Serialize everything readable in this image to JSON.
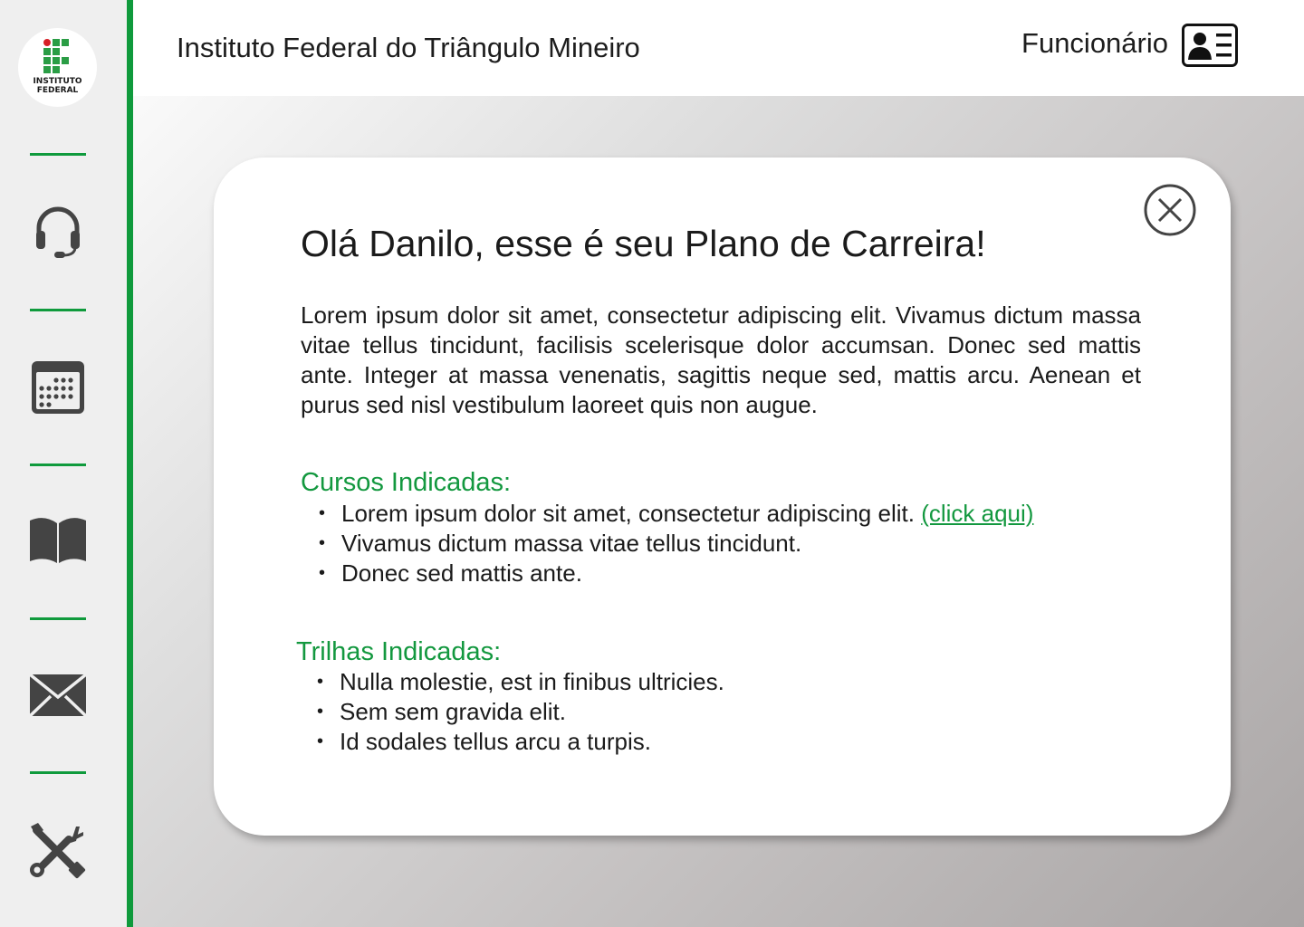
{
  "sidebar": {
    "logo": {
      "line1": "INSTITUTO",
      "line2": "FEDERAL"
    },
    "items": [
      {
        "icon": "headset-icon"
      },
      {
        "icon": "calendar-icon"
      },
      {
        "icon": "book-icon"
      },
      {
        "icon": "mail-icon"
      },
      {
        "icon": "tools-icon"
      }
    ]
  },
  "header": {
    "title": "Instituto Federal do Triângulo Mineiro",
    "user_label": "Funcionário",
    "user_icon": "id-card-icon"
  },
  "modal": {
    "close_icon": "close-icon",
    "title": "Olá Danilo, esse é seu Plano de Carreira!",
    "intro": "Lorem ipsum dolor sit amet, consectetur adipiscing elit. Vivamus dictum massa vitae tellus tincidunt, facilisis scelerisque dolor accumsan.  Donec sed mattis ante. Integer at massa venenatis, sagittis neque sed,  mattis arcu. Aenean et purus sed nisl vestibulum laoreet quis non augue.",
    "courses": {
      "title": "Cursos Indicadas:",
      "items": [
        {
          "text": "Lorem ipsum dolor sit amet, consectetur adipiscing elit. ",
          "link": "(click aqui)"
        },
        {
          "text": "Vivamus dictum  massa vitae tellus tincidunt."
        },
        {
          "text": "Donec sed mattis ante."
        }
      ]
    },
    "tracks": {
      "title": "Trilhas Indicadas:",
      "items": [
        {
          "text": "Nulla molestie, est in finibus ultricies."
        },
        {
          "text": "Sem  sem gravida elit."
        },
        {
          "text": "Id sodales tellus arcu a turpis."
        }
      ]
    }
  },
  "colors": {
    "accent": "#0f9a3c",
    "sidebar_bg": "#efefef",
    "icon": "#444444",
    "text": "#1b1b1b"
  }
}
